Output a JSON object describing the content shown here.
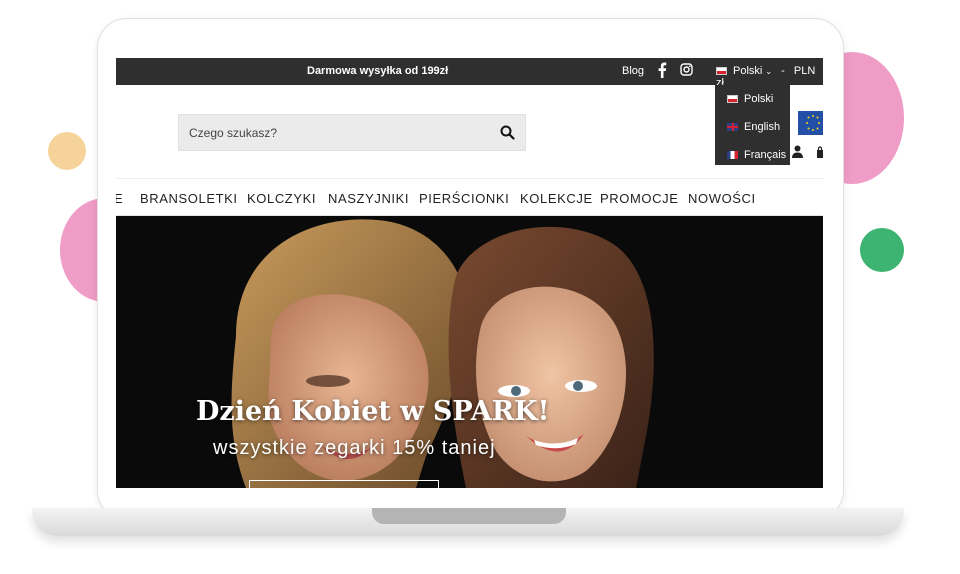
{
  "colors": {
    "topbar_bg": "#2f2f2f",
    "accent_pink": "#ef9cc6",
    "accent_yellow": "#f6d39a",
    "accent_green": "#3eb472"
  },
  "topbar": {
    "shipping": "Darmowa wysyłka od 199zł",
    "blog": "Blog",
    "facebook_icon": "facebook-icon",
    "instagram_icon": "instagram-icon",
    "language": "Polski",
    "currency": "PLN zł",
    "separator": "-"
  },
  "language_menu": {
    "options": [
      {
        "label": "Polski",
        "flag": "flag-pl-icon"
      },
      {
        "label": "English",
        "flag": "flag-gb-icon"
      },
      {
        "label": "Français",
        "flag": "flag-fr-icon"
      }
    ]
  },
  "search": {
    "placeholder": "Czego szukasz?",
    "icon": "search-icon"
  },
  "nav": {
    "items": [
      "E",
      "BRANSOLETKI",
      "KOLCZYKI",
      "NASZYJNIKI",
      "PIERŚCIONKI",
      "KOLEKCJE",
      "PROMOCJE",
      "NOWOŚCI"
    ]
  },
  "hero": {
    "title": "Dzień Kobiet w SPARK!",
    "subtitle": "wszystkie zegarki 15% taniej"
  }
}
